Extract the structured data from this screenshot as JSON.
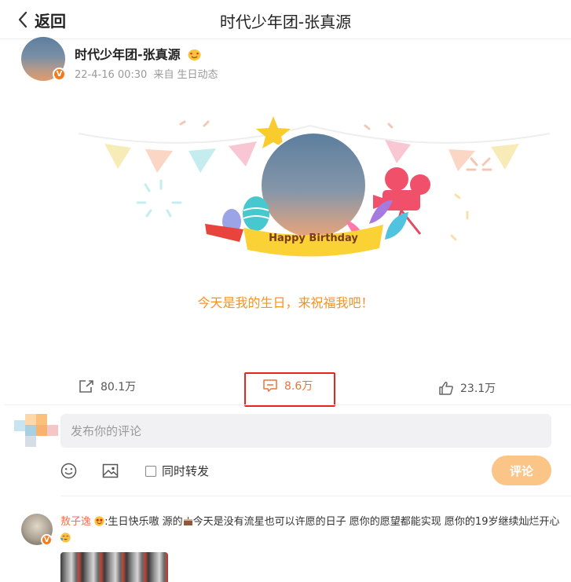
{
  "header": {
    "back_label": "返回",
    "title": "时代少年团-张真源"
  },
  "post": {
    "author": "时代少年团-张真源",
    "verified_badge": "V",
    "date": "22-4-16 00:30",
    "source_prefix": "来自",
    "source": "生日动态",
    "card_banner_text": "Happy Birthday",
    "birthday_message": "今天是我的生日，来祝福我吧！"
  },
  "actions": {
    "repost_count": "80.1万",
    "comment_count": "8.6万",
    "like_count": "23.1万"
  },
  "composer": {
    "placeholder": "发布你的评论",
    "repost_label": "同时转发",
    "submit_label": "评论"
  },
  "comment": {
    "username": "敖子逸",
    "verified_badge": "V",
    "text_part1": ":生日快乐嗷 源的",
    "text_part2": "今天是没有流星也可以许愿的日子 愿你的愿望都能实现 愿你的19岁继续灿烂开心"
  },
  "colors": {
    "accent_orange": "#f59224",
    "highlight_red": "#e8261c",
    "submit_bg": "#fcc588",
    "username_color": "#eb7350"
  }
}
